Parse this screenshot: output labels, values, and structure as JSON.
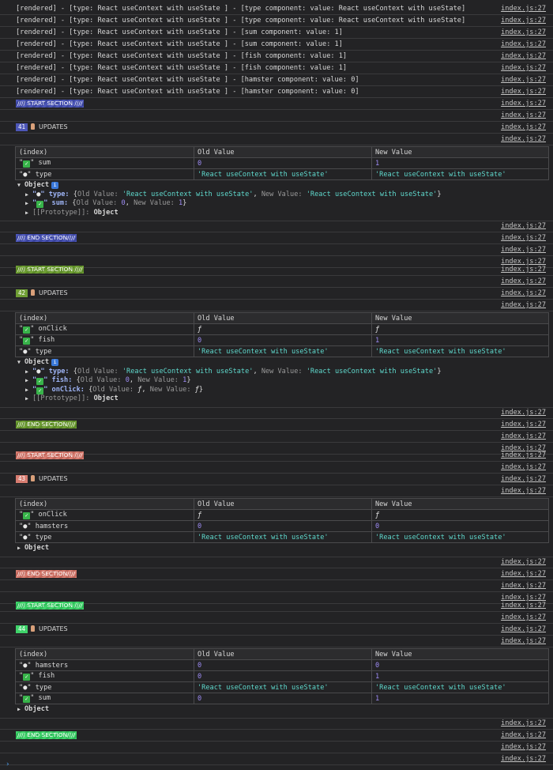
{
  "source_link": "index.js:27",
  "log_lines": [
    "[rendered] - [type: React useContext with useState ] - [type component: value: React useContext with useState]",
    "[rendered] - [type: React useContext with useState ] - [type component: value: React useContext with useState]",
    "[rendered] - [type: React useContext with useState ] - [sum component: value: 1]",
    "[rendered] - [type: React useContext with useState ] - [sum component: value: 1]",
    "[rendered] - [type: React useContext with useState ] - [fish component: value: 1]",
    "[rendered] - [type: React useContext with useState ] - [fish component: value: 1]",
    "[rendered] - [type: React useContext with useState ] - [hamster component: value: 0]",
    "[rendered] - [type: React useContext with useState ] - [hamster component: value: 0]"
  ],
  "start_label": "//// START SECTION ////",
  "end_label": "//// END SECTION////",
  "updates_label": "UPDATES",
  "table_headers": {
    "index": "(index)",
    "old": "Old Value",
    "new": "New Value"
  },
  "object_label": "Object",
  "prototype_label": "[[Prototype]]",
  "prototype_value": "Object",
  "sections": [
    {
      "count": "41",
      "rows": [
        {
          "mark": "check",
          "name": "sum",
          "old": "0",
          "new": "1",
          "kind": "num"
        },
        {
          "mark": "dot",
          "name": "type",
          "old": "'React useContext with useState'",
          "new": "'React useContext with useState'",
          "kind": "str"
        }
      ],
      "object_expanded": true,
      "object_entries": [
        {
          "mark": "dot",
          "key": "type",
          "old": "'React useContext with useState'",
          "new": "'React useContext with useState'",
          "kind": "str"
        },
        {
          "mark": "check",
          "key": "sum",
          "old": "0",
          "new": "1",
          "kind": "num"
        }
      ]
    },
    {
      "count": "42",
      "rows": [
        {
          "mark": "check",
          "name": "onClick",
          "old": "ƒ",
          "new": "ƒ",
          "kind": "fn"
        },
        {
          "mark": "check",
          "name": "fish",
          "old": "0",
          "new": "1",
          "kind": "num"
        },
        {
          "mark": "dot",
          "name": "type",
          "old": "'React useContext with useState'",
          "new": "'React useContext with useState'",
          "kind": "str"
        }
      ],
      "object_expanded": true,
      "object_entries": [
        {
          "mark": "dot",
          "key": "type",
          "old": "'React useContext with useState'",
          "new": "'React useContext with useState'",
          "kind": "str"
        },
        {
          "mark": "check",
          "key": "fish",
          "old": "0",
          "new": "1",
          "kind": "num"
        },
        {
          "mark": "check",
          "key": "onClick",
          "old": "ƒ",
          "new": "ƒ",
          "kind": "fn"
        }
      ]
    },
    {
      "count": "43",
      "rows": [
        {
          "mark": "check",
          "name": "onClick",
          "old": "ƒ",
          "new": "ƒ",
          "kind": "fn"
        },
        {
          "mark": "dot",
          "name": "hamsters",
          "old": "0",
          "new": "0",
          "kind": "num"
        },
        {
          "mark": "dot",
          "name": "type",
          "old": "'React useContext with useState'",
          "new": "'React useContext with useState'",
          "kind": "str"
        }
      ],
      "object_expanded": false,
      "object_entries": []
    },
    {
      "count": "44",
      "rows": [
        {
          "mark": "dot",
          "name": "hamsters",
          "old": "0",
          "new": "0",
          "kind": "num"
        },
        {
          "mark": "check",
          "name": "fish",
          "old": "0",
          "new": "1",
          "kind": "num"
        },
        {
          "mark": "dot",
          "name": "type",
          "old": "'React useContext with useState'",
          "new": "'React useContext with useState'",
          "kind": "str"
        },
        {
          "mark": "check",
          "name": "sum",
          "old": "0",
          "new": "1",
          "kind": "num"
        }
      ],
      "object_expanded": false,
      "object_entries": []
    }
  ],
  "colors": {
    "blue": "#4c56b7",
    "olive": "#6f9e34",
    "salmon": "#d77c70",
    "green": "#3fd36a"
  },
  "icons": {
    "check": "check-emoji-icon",
    "hand": "pointing-hand-icon",
    "info": "info-icon",
    "expand": "triangle-icon"
  }
}
